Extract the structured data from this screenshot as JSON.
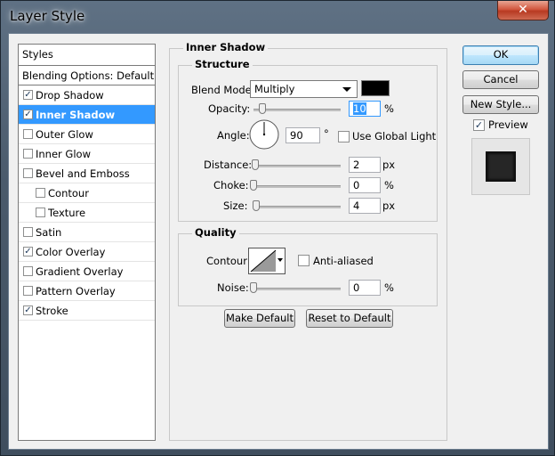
{
  "window": {
    "title": "Layer Style",
    "close_glyph": "✕"
  },
  "styles_panel": {
    "header": "Styles",
    "blending_options": "Blending Options: Default",
    "items": [
      {
        "label": "Drop Shadow",
        "checked": true,
        "selected": false,
        "indent": false
      },
      {
        "label": "Inner Shadow",
        "checked": true,
        "selected": true,
        "indent": false
      },
      {
        "label": "Outer Glow",
        "checked": false,
        "selected": false,
        "indent": false
      },
      {
        "label": "Inner Glow",
        "checked": false,
        "selected": false,
        "indent": false
      },
      {
        "label": "Bevel and Emboss",
        "checked": false,
        "selected": false,
        "indent": false
      },
      {
        "label": "Contour",
        "checked": false,
        "selected": false,
        "indent": true
      },
      {
        "label": "Texture",
        "checked": false,
        "selected": false,
        "indent": true
      },
      {
        "label": "Satin",
        "checked": false,
        "selected": false,
        "indent": false
      },
      {
        "label": "Color Overlay",
        "checked": true,
        "selected": false,
        "indent": false
      },
      {
        "label": "Gradient Overlay",
        "checked": false,
        "selected": false,
        "indent": false
      },
      {
        "label": "Pattern Overlay",
        "checked": false,
        "selected": false,
        "indent": false
      },
      {
        "label": "Stroke",
        "checked": true,
        "selected": false,
        "indent": false
      }
    ]
  },
  "inner_shadow": {
    "title": "Inner Shadow",
    "structure": {
      "title": "Structure",
      "blend_mode_label": "Blend Mode:",
      "blend_mode_value": "Multiply",
      "swatch_color": "#000000",
      "opacity_label": "Opacity:",
      "opacity_value": "10",
      "opacity_unit": "%",
      "opacity_fraction": 0.1,
      "angle_label": "Angle:",
      "angle_value": "90",
      "angle_unit": "°",
      "use_global_light_label": "Use Global Light",
      "use_global_light": false,
      "distance_label": "Distance:",
      "distance_value": "2",
      "distance_unit": "px",
      "choke_label": "Choke:",
      "choke_value": "0",
      "choke_unit": "%",
      "size_label": "Size:",
      "size_value": "4",
      "size_unit": "px"
    },
    "quality": {
      "title": "Quality",
      "contour_label": "Contour:",
      "anti_aliased_label": "Anti-aliased",
      "anti_aliased": false,
      "noise_label": "Noise:",
      "noise_value": "0",
      "noise_unit": "%"
    },
    "make_default_label": "Make Default",
    "reset_default_label": "Reset to Default"
  },
  "actions": {
    "ok_label": "OK",
    "cancel_label": "Cancel",
    "new_style_label": "New Style...",
    "preview_label": "Preview",
    "preview_checked": true
  }
}
